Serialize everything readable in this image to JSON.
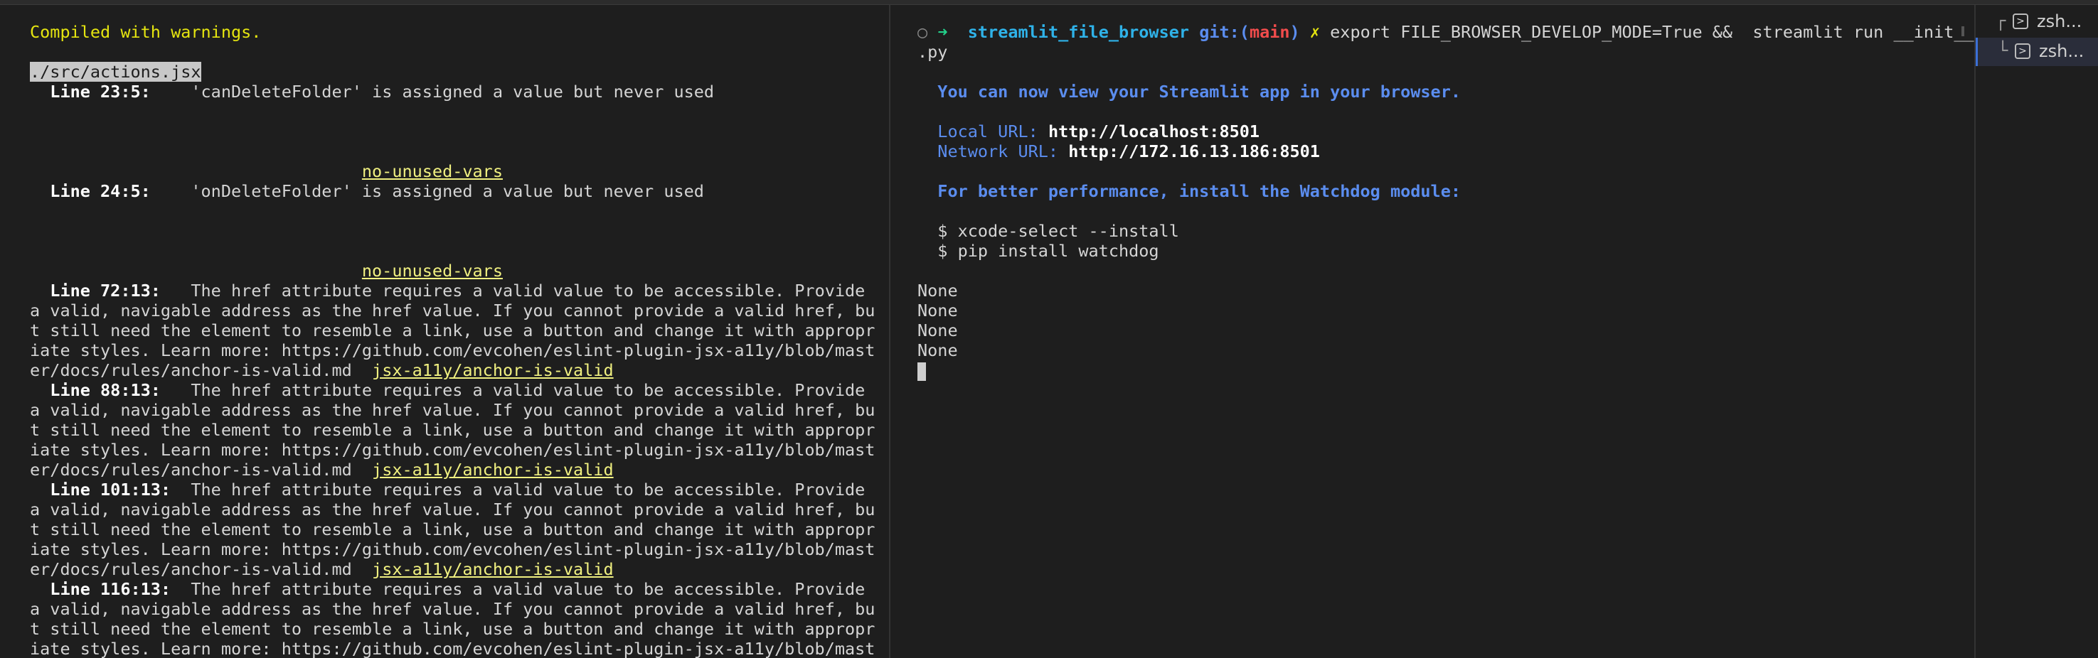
{
  "left_pane": {
    "compiled": "Compiled with warnings.",
    "file": "./src/actions.jsx",
    "w1_loc": "Line 23:5:",
    "w1_msg": "    'canDeleteFolder' is assigned a value but never used",
    "w1_rule": "no-unused-vars",
    "w2_loc": "Line 24:5:",
    "w2_msg": "    'onDeleteFolder' is assigned a value but never used",
    "w2_rule": "no-unused-vars",
    "href_1": "The href attribute requires a valid value to be accessible. Provide",
    "href_2": "a valid, navigable address as the href value. If you cannot provide a valid href, bu",
    "href_3": "t still need the element to resemble a link, use a button and change it with appropr",
    "href_4": "iate styles. Learn more: https://github.com/evcohen/eslint-plugin-jsx-a11y/blob/mast",
    "href_5": "er/docs/rules/anchor-is-valid.md",
    "a11y_rule": "jsx-a11y/anchor-is-valid",
    "w3_loc": "Line 72:13:",
    "w4_loc": "Line 88:13:",
    "w5_loc": "Line 101:13:",
    "w6_loc": "Line 116:13:"
  },
  "right_pane": {
    "prompt_circle": "○",
    "prompt_arrow": "➜",
    "dir": "streamlit_file_browser",
    "git_label": "git:(",
    "branch": "main",
    "git_close": ")",
    "dirty": "✗",
    "command": "export FILE_BROWSER_DEVELOP_MODE=True &&  streamlit run __init__",
    "command_wrap": ".py",
    "view_msg": "You can now view your Streamlit app in your browser.",
    "local_label": "Local URL: ",
    "local_url": "http://localhost:8501",
    "network_label": "Network URL: ",
    "network_url": "http://172.16.13.186:8501",
    "perf_msg": "For better performance, install the Watchdog module:",
    "cmd1": "$ xcode-select --install",
    "cmd2": "$ pip install watchdog",
    "outputs": [
      "None",
      "None",
      "None",
      "None"
    ]
  },
  "tabs": [
    {
      "tree": "┌",
      "label": "zsh..."
    },
    {
      "tree": "└",
      "label": "zsh..."
    }
  ]
}
